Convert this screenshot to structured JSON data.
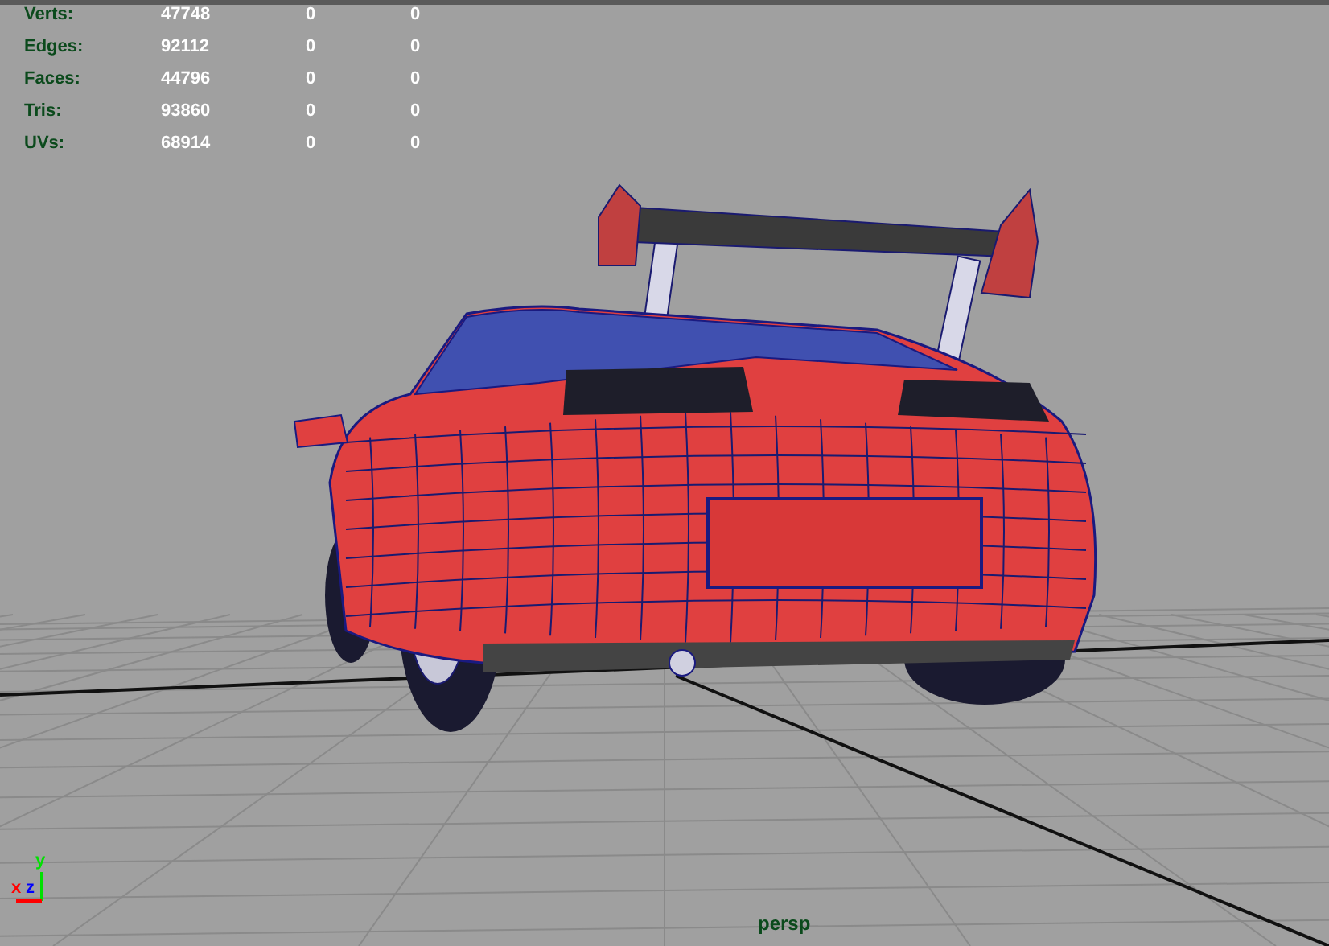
{
  "stats": [
    {
      "label": "Verts:",
      "values": [
        "47748",
        "0",
        "0"
      ]
    },
    {
      "label": "Edges:",
      "values": [
        "92112",
        "0",
        "0"
      ]
    },
    {
      "label": "Faces:",
      "values": [
        "44796",
        "0",
        "0"
      ]
    },
    {
      "label": "Tris:",
      "values": [
        "93860",
        "0",
        "0"
      ]
    },
    {
      "label": "UVs:",
      "values": [
        "68914",
        "0",
        "0"
      ]
    }
  ],
  "axes": [
    {
      "label": "x",
      "color": "#ff0000"
    },
    {
      "label": "y",
      "color": "#00e000"
    },
    {
      "label": "z",
      "color": "#0000ff"
    }
  ],
  "camera": "persp"
}
